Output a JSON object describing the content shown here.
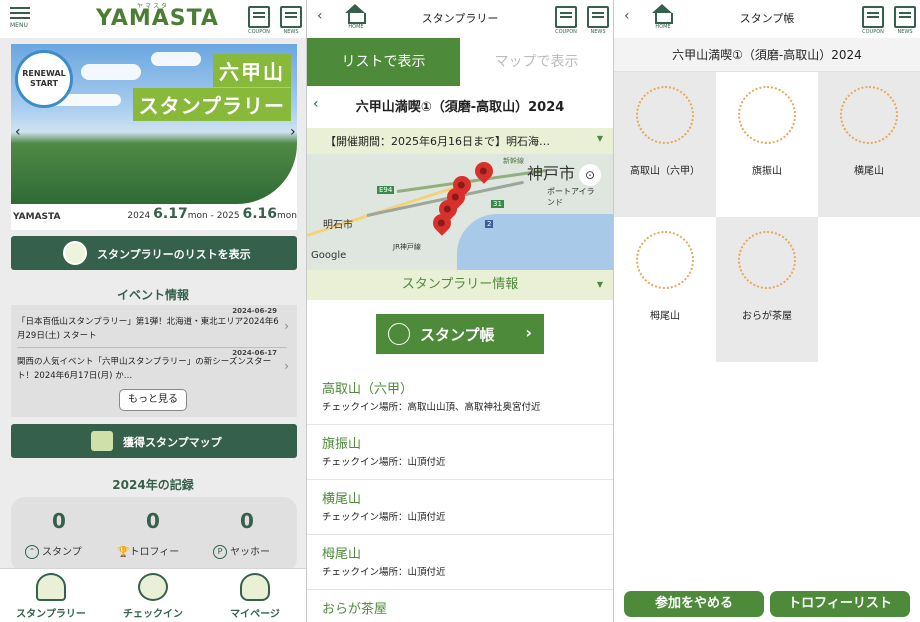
{
  "home": {
    "menu_label": "MENU",
    "logo": "YAMASTA",
    "logo_kana": "ヤマスタ",
    "coupon_label": "COUPON",
    "news_label": "NEWS",
    "banner": {
      "badge_line1": "RENEWAL",
      "badge_line2": "START",
      "title_line1": "六甲山",
      "title_line2": "スタンプラリー",
      "brand": "YAMASTA",
      "date_start_year": "2024",
      "date_start": "6.17",
      "date_start_day": "mon",
      "date_sep": "-",
      "date_end_year": "2025",
      "date_end": "6.16",
      "date_end_day": "mon"
    },
    "list_button": "スタンプラリーのリストを表示",
    "events_title": "イベント情報",
    "events": [
      {
        "text": "「日本百低山スタンプラリー」第1弾！北海道・東北エリア2024年6月29日(土) スタート",
        "date": "2024-06-29"
      },
      {
        "text": "関西の人気イベント「六甲山スタンプラリー」の新シーズンスタート！2024年6月17日(月) か…",
        "date": "2024-06-17"
      }
    ],
    "more_button": "もっと見る",
    "map_button": "獲得スタンプマップ",
    "record_title": "2024年の記録",
    "records": [
      {
        "value": "0",
        "label": "スタンプ",
        "icon": "stamp-icon"
      },
      {
        "value": "0",
        "label": "トロフィー",
        "icon": "trophy-icon"
      },
      {
        "value": "0",
        "label": "ヤッホー",
        "icon": "yahho-icon"
      }
    ],
    "tabs": [
      {
        "label": "スタンプラリー",
        "icon": "stamp-rally-icon"
      },
      {
        "label": "チェックイン",
        "icon": "checkin-icon"
      },
      {
        "label": "マイページ",
        "icon": "mypage-icon"
      }
    ]
  },
  "rally": {
    "home_label": "HOME",
    "header_title": "スタンプラリー",
    "coupon_label": "COUPON",
    "news_label": "NEWS",
    "tab_list": "リストで表示",
    "tab_map": "マップで表示",
    "title": "六甲山満喫①（須磨-高取山）2024",
    "period": "【開催期間：2025年6月16日まで】明石海…",
    "map_labels": {
      "city1": "神戸市",
      "city2": "明石市",
      "port": "ポートアイランド",
      "rail": "新幹線",
      "jr": "JR神戸線",
      "google": "Google",
      "r94": "E94",
      "r31": "31",
      "r2": "2"
    },
    "info_bar": "スタンプラリー情報",
    "stamp_book_button": "スタンプ帳",
    "mountains": [
      {
        "name": "高取山（六甲）",
        "checkin": "チェックイン場所：高取山山頂、高取神社奥宮付近"
      },
      {
        "name": "旗振山",
        "checkin": "チェックイン場所：山頂付近"
      },
      {
        "name": "横尾山",
        "checkin": "チェックイン場所：山頂付近"
      },
      {
        "name": "栂尾山",
        "checkin": "チェックイン場所：山頂付近"
      },
      {
        "name": "おらが茶屋",
        "checkin": ""
      }
    ]
  },
  "stamp_book": {
    "home_label": "HOME",
    "header_title": "スタンプ帳",
    "coupon_label": "COUPON",
    "news_label": "NEWS",
    "title": "六甲山満喫①（須磨-高取山）2024",
    "cells": [
      {
        "name": "高取山（六甲）"
      },
      {
        "name": "旗振山"
      },
      {
        "name": "横尾山"
      },
      {
        "name": "栂尾山"
      },
      {
        "name": "おらが茶屋"
      }
    ],
    "quit_button": "参加をやめる",
    "trophy_button": "トロフィーリスト"
  },
  "colors": {
    "primary_dark": "#35614c",
    "primary": "#4d8b3a",
    "accent": "#88b93b",
    "pin": "#d8302c"
  }
}
